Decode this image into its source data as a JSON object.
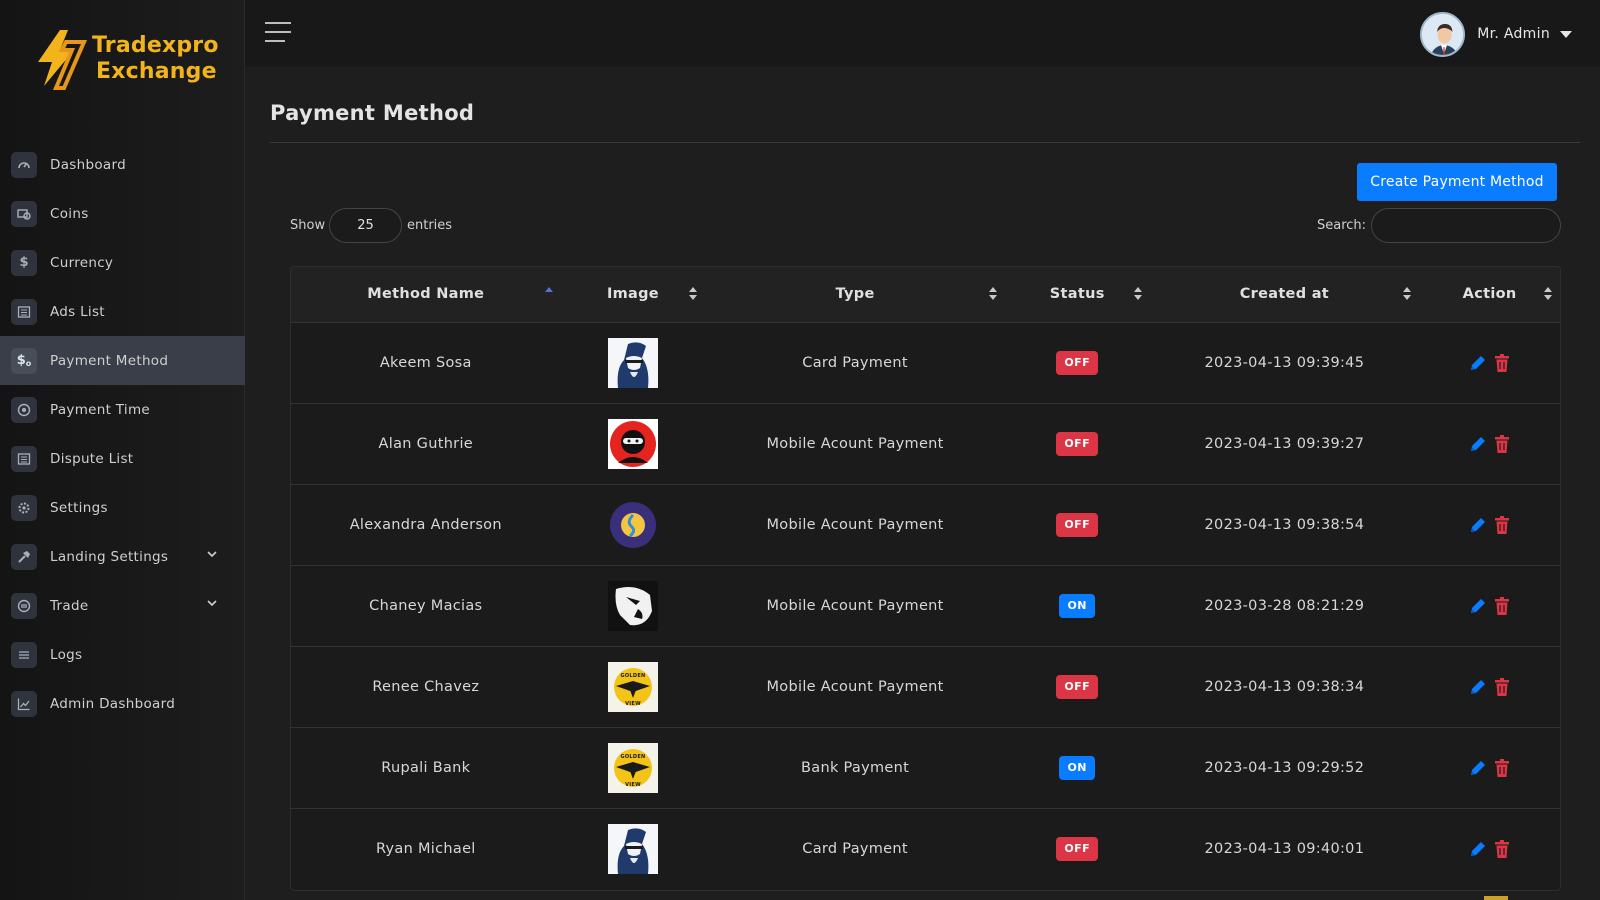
{
  "brand": {
    "line1": "Tradexpro",
    "line2": "Exchange"
  },
  "sidebar": {
    "items": [
      {
        "label": "Dashboard",
        "icon": "speedometer-icon"
      },
      {
        "label": "Coins",
        "icon": "coins-icon"
      },
      {
        "label": "Currency",
        "icon": "dollar-icon"
      },
      {
        "label": "Ads List",
        "icon": "list-icon"
      },
      {
        "label": "Payment Method",
        "icon": "payment-icon",
        "active": true
      },
      {
        "label": "Payment Time",
        "icon": "clock-icon"
      },
      {
        "label": "Dispute List",
        "icon": "list-icon"
      },
      {
        "label": "Settings",
        "icon": "gear-icon"
      },
      {
        "label": "Landing Settings",
        "icon": "hammer-icon",
        "expandable": true
      },
      {
        "label": "Trade",
        "icon": "trade-icon",
        "expandable": true
      },
      {
        "label": "Logs",
        "icon": "logs-icon"
      },
      {
        "label": "Admin Dashboard",
        "icon": "chart-icon"
      }
    ]
  },
  "header": {
    "user_name": "Mr. Admin"
  },
  "page": {
    "title": "Payment Method",
    "create_button": "Create Payment Method",
    "show_label": "Show",
    "entries_value": "25",
    "entries_label": "entries",
    "search_label": "Search:",
    "search_value": ""
  },
  "table": {
    "columns": [
      "Method Name",
      "Image",
      "Type",
      "Status",
      "Created at",
      "Action"
    ],
    "rows": [
      {
        "name": "Akeem Sosa",
        "image": "thief-logo",
        "type": "Card Payment",
        "status": "OFF",
        "created": "2023-04-13 09:39:45"
      },
      {
        "name": "Alan Guthrie",
        "image": "ninja-logo",
        "type": "Mobile Acount Payment",
        "status": "OFF",
        "created": "2023-04-13 09:39:27"
      },
      {
        "name": "Alexandra Anderson",
        "image": "coin-circle-logo",
        "type": "Mobile Acount Payment",
        "status": "OFF",
        "created": "2023-04-13 09:38:54"
      },
      {
        "name": "Chaney Macias",
        "image": "bw-face-logo",
        "type": "Mobile Acount Payment",
        "status": "ON",
        "created": "2023-03-28 08:21:29"
      },
      {
        "name": "Renee Chavez",
        "image": "golden-view-logo",
        "type": "Mobile Acount Payment",
        "status": "OFF",
        "created": "2023-04-13 09:38:34"
      },
      {
        "name": "Rupali Bank",
        "image": "golden-view-logo",
        "type": "Bank Payment",
        "status": "ON",
        "created": "2023-04-13 09:29:52"
      },
      {
        "name": "Ryan Michael",
        "image": "thief-logo",
        "type": "Card Payment",
        "status": "OFF",
        "created": "2023-04-13 09:40:01"
      }
    ]
  },
  "colors": {
    "accent": "#0a7cff",
    "danger": "#dc3545",
    "brand": "#f3b41b",
    "sidebar_active": "#393e48"
  }
}
